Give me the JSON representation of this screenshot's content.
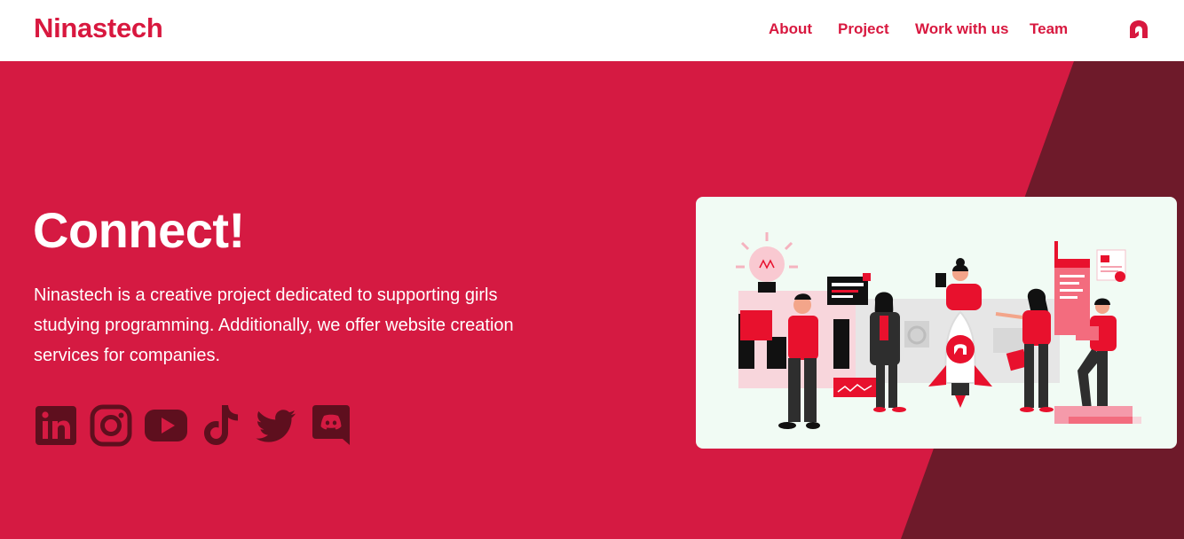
{
  "header": {
    "brand": "Ninastech",
    "nav": [
      {
        "label": "About"
      },
      {
        "label": "Project"
      },
      {
        "label": "Work with us"
      },
      {
        "label": "Team"
      }
    ],
    "logo_icon": "ninastech-logo-icon"
  },
  "hero": {
    "headline": "Connect!",
    "description": "Ninastech is a creative project dedicated to supporting girls studying programming. Additionally, we offer website creation services for companies.",
    "socials": [
      {
        "icon": "linkedin-icon"
      },
      {
        "icon": "instagram-icon"
      },
      {
        "icon": "youtube-icon"
      },
      {
        "icon": "tiktok-icon"
      },
      {
        "icon": "twitter-icon"
      },
      {
        "icon": "discord-icon"
      }
    ],
    "illustration": "team-rocket-illustration"
  },
  "colors": {
    "brand": "#d8183f",
    "hero_bg": "#d51a42",
    "hero_dark": "#6e1a2a",
    "social_icon": "#5e0f1e",
    "card_bg": "#f1fbf4"
  }
}
